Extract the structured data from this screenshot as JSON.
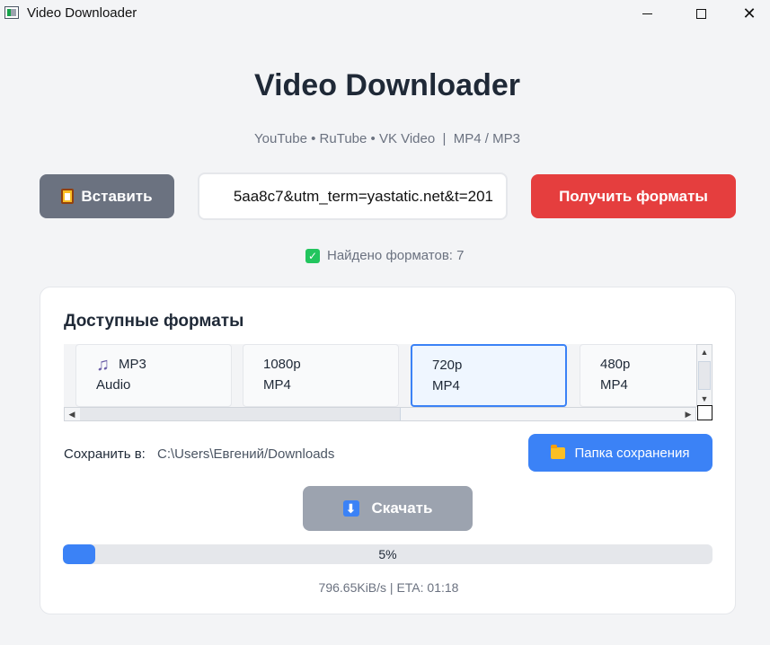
{
  "window": {
    "title": "Video Downloader",
    "minimize_glyph": "",
    "maximize_glyph": "",
    "close_glyph": "✕"
  },
  "header": {
    "title": "Video Downloader",
    "subtitle": "YouTube • RuTube • VK Video  |  MP4 / MP3"
  },
  "toolbar": {
    "paste_label": "Вставить",
    "url_value": "5aa8c7&utm_term=yastatic.net&t=201",
    "get_formats_label": "Получить форматы"
  },
  "status": {
    "text": "Найдено форматов: 7",
    "check_glyph": "✓"
  },
  "formats": {
    "title": "Доступные форматы",
    "items": [
      {
        "quality": "MP3",
        "container": "Audio",
        "icon": "music-note-icon"
      },
      {
        "quality": "1080p",
        "container": "MP4"
      },
      {
        "quality": "720p",
        "container": "MP4",
        "selected": true
      },
      {
        "quality": "480p",
        "container": "MP4"
      }
    ]
  },
  "save": {
    "label": "Сохранить в:",
    "path": "C:\\Users\\Евгений/Downloads",
    "folder_button": "Папка сохранения"
  },
  "download": {
    "label": "Скачать",
    "arrow_glyph": "⬇"
  },
  "progress": {
    "percent": 5,
    "label": "5%",
    "info": "796.65KiB/s | ETA: 01:18"
  },
  "colors": {
    "primary_blue": "#3b82f6",
    "danger_red": "#e53e3e",
    "neutral_gray": "#6b7280",
    "disabled_gray": "#9ca3af",
    "success_green": "#22c55e"
  }
}
